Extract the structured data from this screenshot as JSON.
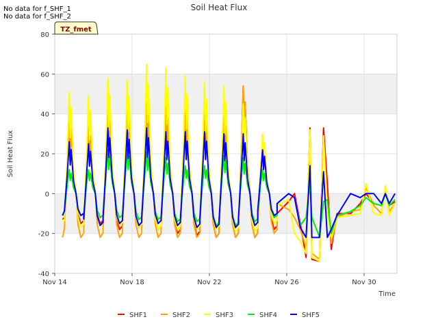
{
  "no_data_notes": [
    "No data for f_SHF_1",
    "No data for f_SHF_2"
  ],
  "badge": "TZ_fmet",
  "chart_data": {
    "type": "line",
    "title": "Soil Heat Flux",
    "xlabel": "Time",
    "ylabel": "Soil Heat Flux",
    "x_unit": "days of November",
    "xlim": [
      14,
      31.7
    ],
    "ylim": [
      -40,
      80
    ],
    "x_ticks": [
      {
        "value": 14,
        "label": "Nov 14"
      },
      {
        "value": 18,
        "label": "Nov 18"
      },
      {
        "value": 22,
        "label": "Nov 22"
      },
      {
        "value": 26,
        "label": "Nov 26"
      },
      {
        "value": 30,
        "label": "Nov 30"
      }
    ],
    "y_ticks": [
      -40,
      -20,
      0,
      20,
      40,
      60,
      80
    ],
    "bands": [
      [
        -20,
        0
      ],
      [
        40,
        60
      ],
      [
        80,
        100
      ]
    ],
    "grid": true,
    "legend_position": "bottom",
    "colors": {
      "SHF1": "#ff0000",
      "SHF2": "#ffa500",
      "SHF3": "#ffff00",
      "SHF4": "#00ee00",
      "SHF5": "#0000ff"
    },
    "daily_peaks": {
      "SHF1": [
        38,
        34,
        43,
        42,
        46,
        44,
        45,
        41,
        40,
        54,
        24
      ],
      "SHF2": [
        38,
        34,
        43,
        42,
        46,
        44,
        44,
        41,
        40,
        54,
        22
      ],
      "SHF3": [
        51,
        49,
        58,
        57,
        65,
        63,
        59,
        56,
        54,
        45,
        30
      ],
      "SHF4": [
        12,
        12,
        22,
        22,
        21,
        18,
        14,
        14,
        19,
        18,
        12
      ],
      "SHF5": [
        26,
        25,
        33,
        32,
        33,
        31,
        31,
        31,
        30,
        30,
        22
      ]
    },
    "daily_troughs": {
      "SHF1": [
        -15,
        -15,
        -18,
        -17,
        -18,
        -20,
        -21,
        -22,
        -22,
        -22,
        -18
      ],
      "SHF2": [
        -22,
        -22,
        -22,
        -22,
        -22,
        -22,
        -22,
        -22,
        -22,
        -22,
        -20
      ],
      "SHF3": [
        -17,
        -16,
        -16,
        -17,
        -18,
        -18,
        -18,
        -18,
        -19,
        -19,
        -15
      ],
      "SHF4": [
        -11,
        -12,
        -12,
        -13,
        -13,
        -14,
        -14,
        -16,
        -16,
        -14,
        -12
      ],
      "SHF5": [
        -11,
        -16,
        -15,
        -16,
        -15,
        -16,
        -17,
        -17,
        -17,
        -16,
        -11
      ]
    },
    "late_period": {
      "SHF1": [
        [
          25.5,
          -10
        ],
        [
          26.1,
          -4
        ],
        [
          26.4,
          0
        ],
        [
          26.7,
          -15
        ],
        [
          27.0,
          -32
        ],
        [
          27.2,
          33
        ],
        [
          27.3,
          -33
        ],
        [
          27.7,
          -34
        ],
        [
          27.9,
          33
        ],
        [
          28.1,
          5
        ],
        [
          28.3,
          -28
        ],
        [
          28.6,
          -10
        ],
        [
          29.3,
          -10
        ],
        [
          29.8,
          -5
        ],
        [
          30.1,
          0
        ],
        [
          30.5,
          -5
        ],
        [
          30.9,
          -6
        ],
        [
          31.1,
          0
        ],
        [
          31.3,
          -6
        ],
        [
          31.6,
          -4
        ]
      ],
      "SHF2": [
        [
          25.5,
          -5
        ],
        [
          26.1,
          -8
        ],
        [
          26.4,
          -12
        ],
        [
          26.7,
          -18
        ],
        [
          27.0,
          -27
        ],
        [
          27.2,
          30
        ],
        [
          27.3,
          -30
        ],
        [
          27.7,
          -33
        ],
        [
          27.9,
          28
        ],
        [
          28.1,
          -5
        ],
        [
          28.3,
          -25
        ],
        [
          28.6,
          -12
        ],
        [
          29.3,
          -9
        ],
        [
          29.8,
          -8
        ],
        [
          30.1,
          3
        ],
        [
          30.5,
          -6
        ],
        [
          30.9,
          -10
        ],
        [
          31.1,
          3
        ],
        [
          31.3,
          -9
        ],
        [
          31.6,
          -5
        ]
      ],
      "SHF3": [
        [
          25.5,
          -6
        ],
        [
          26.1,
          -3
        ],
        [
          26.4,
          -20
        ],
        [
          26.7,
          -24
        ],
        [
          27.0,
          -30
        ],
        [
          27.2,
          32
        ],
        [
          27.3,
          -32
        ],
        [
          27.7,
          -34
        ],
        [
          27.9,
          29
        ],
        [
          28.1,
          -10
        ],
        [
          28.3,
          -22
        ],
        [
          28.6,
          -12
        ],
        [
          29.3,
          -11
        ],
        [
          29.8,
          -10
        ],
        [
          30.1,
          5
        ],
        [
          30.5,
          -10
        ],
        [
          30.9,
          -11
        ],
        [
          31.1,
          4
        ],
        [
          31.3,
          -11
        ],
        [
          31.6,
          -5
        ]
      ],
      "SHF4": [
        [
          25.5,
          -5
        ],
        [
          26.1,
          0
        ],
        [
          26.4,
          -2
        ],
        [
          26.7,
          -16
        ],
        [
          27.0,
          -12
        ],
        [
          27.2,
          5
        ],
        [
          27.3,
          -12
        ],
        [
          27.7,
          -22
        ],
        [
          27.9,
          -4
        ],
        [
          28.1,
          -3
        ],
        [
          28.3,
          -20
        ],
        [
          28.6,
          -11
        ],
        [
          29.3,
          -9
        ],
        [
          29.8,
          -6
        ],
        [
          30.1,
          -2
        ],
        [
          30.5,
          -5
        ],
        [
          30.9,
          -6
        ],
        [
          31.1,
          0
        ],
        [
          31.3,
          -6
        ],
        [
          31.6,
          -3
        ]
      ],
      "SHF5": [
        [
          25.5,
          -5
        ],
        [
          26.1,
          0
        ],
        [
          26.4,
          -2
        ],
        [
          26.7,
          -17
        ],
        [
          27.0,
          -22
        ],
        [
          27.2,
          14
        ],
        [
          27.3,
          -22
        ],
        [
          27.7,
          -22
        ],
        [
          27.9,
          11
        ],
        [
          28.1,
          -22
        ],
        [
          28.3,
          -18
        ],
        [
          28.6,
          -11
        ],
        [
          29.3,
          0
        ],
        [
          29.8,
          -2
        ],
        [
          30.1,
          0
        ],
        [
          30.5,
          0
        ],
        [
          30.9,
          -5
        ],
        [
          31.1,
          0
        ],
        [
          31.3,
          -5
        ],
        [
          31.6,
          0
        ]
      ]
    }
  }
}
